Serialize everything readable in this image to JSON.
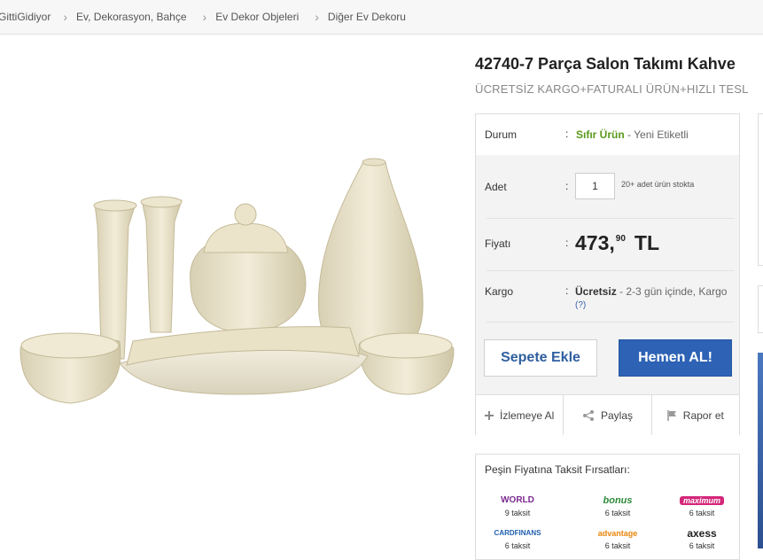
{
  "breadcrumb": [
    "GittiGidiyor",
    "Ev, Dekorasyon, Bahçe",
    "Ev Dekor Objeleri",
    "Diğer Ev Dekoru"
  ],
  "product": {
    "title": "42740-7 Parça Salon Takımı Kahve",
    "subtitle": "ÜCRETSİZ KARGO+FATURALI ÜRÜN+HIZLI TESL"
  },
  "details": {
    "durum_label": "Durum",
    "durum_value": "Sıfır Ürün",
    "durum_extra": " - Yeni Etiketli",
    "adet_label": "Adet",
    "quantity": "1",
    "stock_text": "20+ adet ürün stokta",
    "fiyat_label": "Fiyatı",
    "price_int": "473,",
    "price_dec": "90",
    "currency": "TL",
    "kargo_label": "Kargo",
    "kargo_free": "Ücretsiz",
    "kargo_time": " - 2-3 gün içinde, Kargo",
    "kargo_help": "(?)",
    "colon": ":"
  },
  "buttons": {
    "add_to_cart": "Sepete Ekle",
    "buy_now": "Hemen AL!"
  },
  "actions": {
    "watch": "İzlemeye Al",
    "share": "Paylaş",
    "report": "Rapor et"
  },
  "installments": {
    "title": "Peşin Fiyatına Taksit Fırsatları:",
    "cards": [
      {
        "name": "WORLD",
        "count": "9 taksit",
        "color": "#7b2a8f"
      },
      {
        "name": "bonus",
        "count": "6 taksit",
        "color": "#2e8b3a"
      },
      {
        "name": "maximum",
        "count": "6 taksit",
        "color": "#d4277a"
      },
      {
        "name": "CARDFINANS",
        "count": "6 taksit",
        "color": "#1f5fb0"
      },
      {
        "name": "advantage",
        "count": "6 taksit",
        "color": "#e8850c"
      },
      {
        "name": "axess",
        "count": "6 taksit",
        "color": "#222222"
      }
    ]
  },
  "colors": {
    "accent": "#2d62b5",
    "green": "#5a9a1a"
  }
}
